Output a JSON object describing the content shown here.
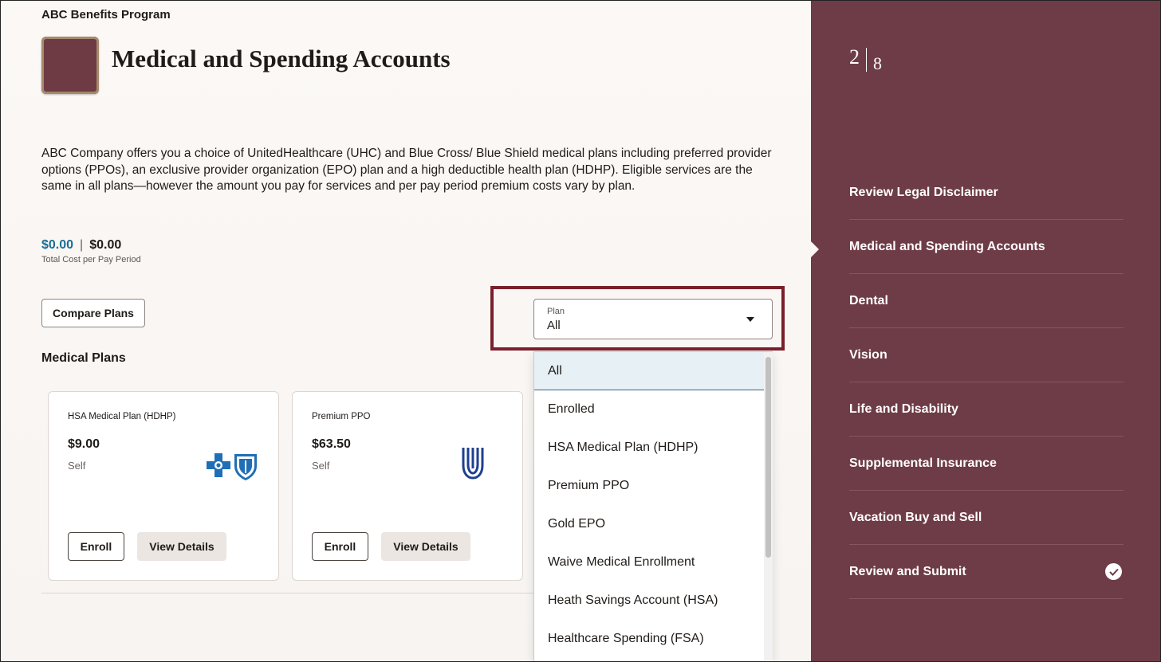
{
  "header": {
    "program_title": "ABC Benefits Program",
    "page_title": "Medical and Spending Accounts"
  },
  "description": "ABC Company offers you a choice of UnitedHealthcare (UHC) and Blue Cross/ Blue Shield medical plans including preferred provider options (PPOs), an exclusive provider organization (EPO) plan and a high deductible health plan (HDHP). Eligible services are the same in all plans—however the amount you pay for services and per pay period premium costs vary by plan.",
  "cost": {
    "employee_cost": "$0.00",
    "separator": "|",
    "total_cost": "$0.00",
    "label": "Total Cost per Pay Period"
  },
  "toolbar": {
    "compare_label": "Compare Plans"
  },
  "plan_filter": {
    "label": "Plan",
    "value": "All",
    "options": [
      "All",
      "Enrolled",
      "HSA Medical Plan (HDHP)",
      "Premium PPO",
      "Gold EPO",
      "Waive Medical Enrollment",
      "Heath Savings Account (HSA)",
      "Healthcare Spending (FSA)"
    ],
    "selected_index": 0
  },
  "section": {
    "heading": "Medical Plans"
  },
  "plans": [
    {
      "name": "HSA Medical Plan (HDHP)",
      "price": "$9.00",
      "coverage": "Self",
      "logo": "bcbs-logo-icon",
      "enroll_label": "Enroll",
      "details_label": "View Details"
    },
    {
      "name": "Premium PPO",
      "price": "$63.50",
      "coverage": "Self",
      "logo": "uhc-logo-icon",
      "enroll_label": "Enroll",
      "details_label": "View Details"
    }
  ],
  "sidebar": {
    "current_step": "2",
    "total_steps": "8",
    "steps": [
      {
        "label": "Review Legal Disclaimer",
        "current": false,
        "complete": false
      },
      {
        "label": "Medical and Spending Accounts",
        "current": true,
        "complete": false
      },
      {
        "label": "Dental",
        "current": false,
        "complete": false
      },
      {
        "label": "Vision",
        "current": false,
        "complete": false
      },
      {
        "label": "Life and Disability",
        "current": false,
        "complete": false
      },
      {
        "label": "Supplemental Insurance",
        "current": false,
        "complete": false
      },
      {
        "label": "Vacation Buy and Sell",
        "current": false,
        "complete": false
      },
      {
        "label": "Review and Submit",
        "current": false,
        "complete": true
      }
    ]
  },
  "colors": {
    "sidebar_bg": "#6e3c46",
    "accent_cost": "#1a6e94",
    "highlight_border": "#7a1f2b",
    "selected_option_bg": "#e6f0f5"
  }
}
